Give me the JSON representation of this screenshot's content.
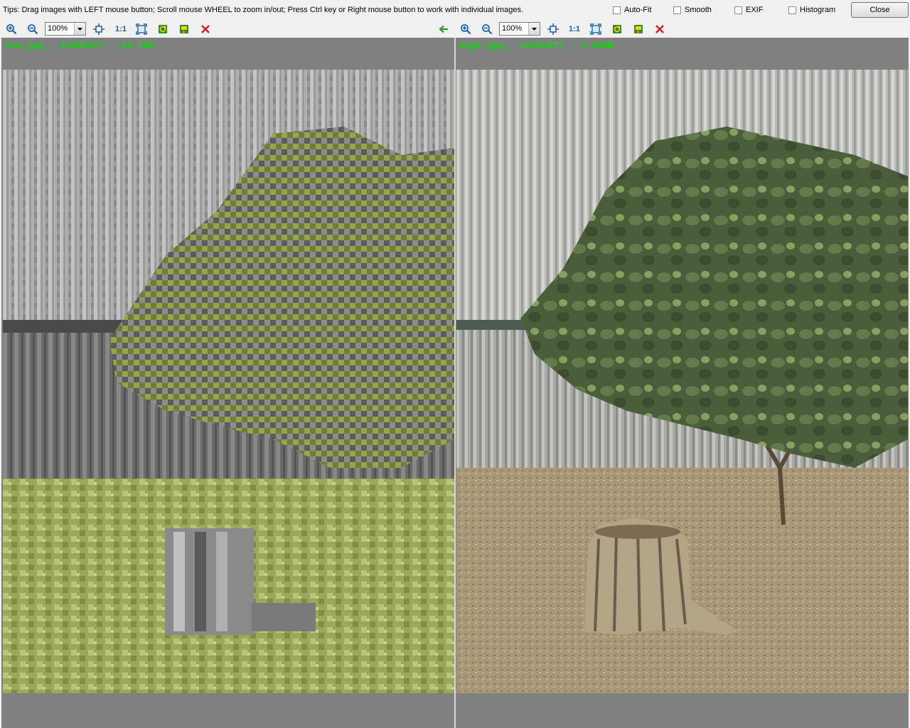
{
  "tips": "Tips: Drag images with LEFT mouse button; Scroll mouse WHEEL to zoom in/out; Press Ctrl key or Right mouse button to work with individual images.",
  "options": [
    {
      "label": "Auto-Fit",
      "checked": false
    },
    {
      "label": "Smooth",
      "checked": false
    },
    {
      "label": "EXIF",
      "checked": false
    },
    {
      "label": "Histogram",
      "checked": false
    }
  ],
  "close_label": "Close",
  "left": {
    "zoom": "100%",
    "one_to_one": "1:1",
    "caption": "low.jpg , 1230x877 , 23.7KB"
  },
  "right": {
    "zoom": "100%",
    "one_to_one": "1:1",
    "caption": "high.jpg , 1230x877 , 2.04MB"
  },
  "colors": {
    "caption": "#00e000",
    "background": "#808080",
    "close_icon": "#d42020",
    "arrow_icon": "#2a9d2a"
  },
  "icons": [
    "zoom-in-icon",
    "zoom-out-icon",
    "fit-icon",
    "fullscreen-icon",
    "rotate-icon",
    "save-icon",
    "remove-icon",
    "sync-arrow-icon"
  ]
}
